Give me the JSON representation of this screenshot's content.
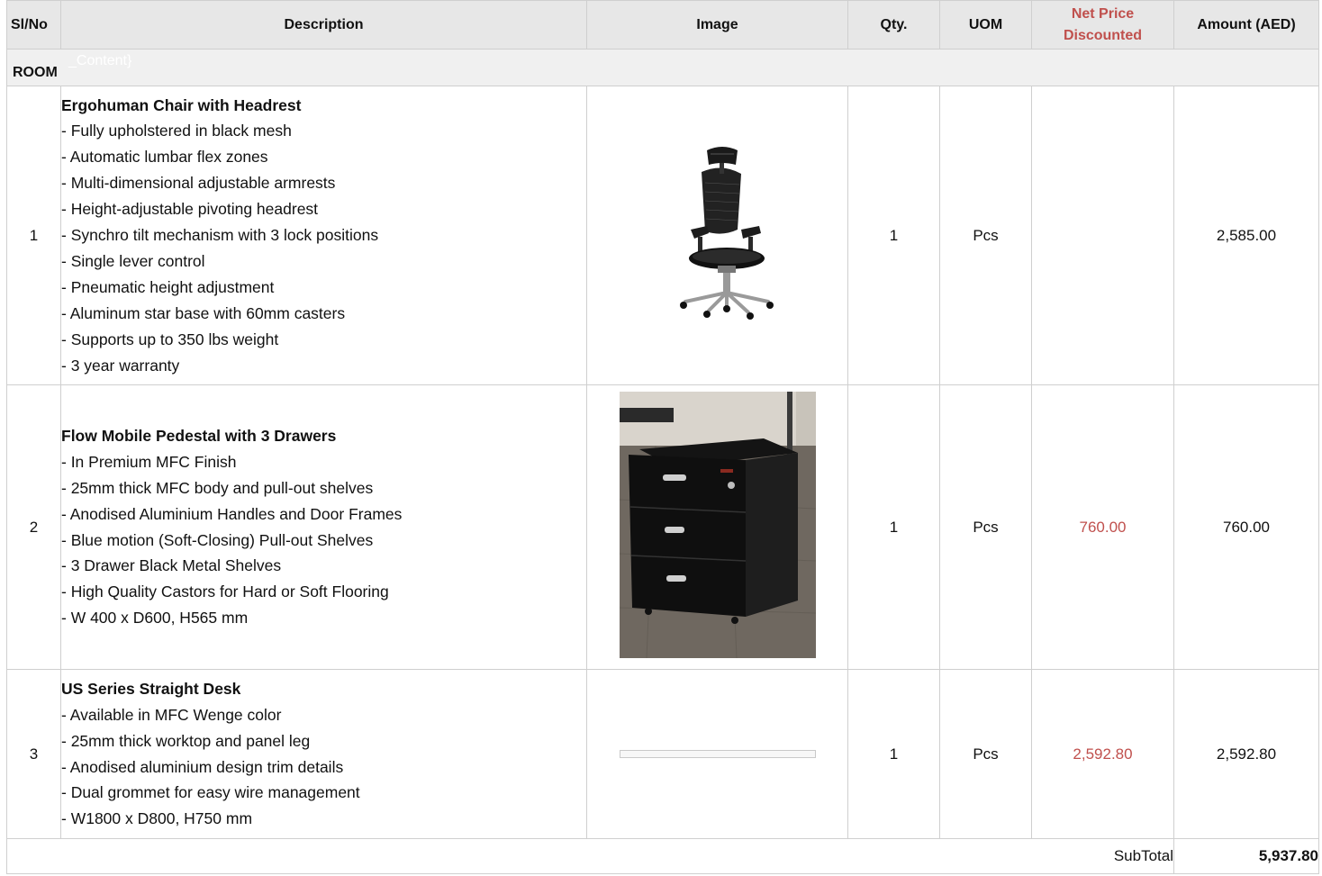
{
  "columns": {
    "slno": "Sl/No",
    "description": "Description",
    "image": "Image",
    "qty": "Qty.",
    "uom": "UOM",
    "net_price_line1": "Net Price",
    "net_price_line2": "Discounted",
    "amount": "Amount (AED)"
  },
  "section": {
    "label": "ROOM",
    "ghost_text": "_Content}"
  },
  "rows": [
    {
      "slno": "1",
      "title": "Ergohuman Chair with Headrest",
      "lines": [
        "- Fully upholstered in black mesh",
        "- Automatic lumbar flex zones",
        "- Multi-dimensional adjustable armrests",
        "- Height-adjustable pivoting headrest",
        "- Synchro tilt mechanism with 3 lock positions",
        "- Single lever control",
        "- Pneumatic height adjustment",
        "- Aluminum star base with 60mm casters",
        "- Supports up to 350 lbs weight",
        "- 3 year warranty"
      ],
      "image_icon": "office-chair-photo",
      "qty": "1",
      "uom": "Pcs",
      "net_price": "",
      "amount": "2,585.00"
    },
    {
      "slno": "2",
      "title": "Flow Mobile Pedestal with 3 Drawers",
      "lines": [
        "- In Premium MFC Finish",
        "- 25mm thick MFC body and pull-out shelves",
        "- Anodised Aluminium Handles and Door Frames",
        "- Blue motion (Soft-Closing) Pull-out Shelves",
        "- 3 Drawer Black Metal Shelves",
        "- High Quality Castors for Hard or Soft Flooring",
        "- W 400 x D600, H565 mm"
      ],
      "image_icon": "pedestal-photo",
      "qty": "1",
      "uom": "Pcs",
      "net_price": "760.00",
      "amount": "760.00"
    },
    {
      "slno": "3",
      "title": "US Series Straight Desk",
      "lines": [
        "- Available in MFC Wenge color",
        "- 25mm thick worktop and panel leg",
        "- Anodised aluminium design trim details",
        "- Dual grommet for easy wire management",
        "- W1800 x D800, H750 mm"
      ],
      "image_icon": "desk-photo",
      "qty": "1",
      "uom": "Pcs",
      "net_price": "2,592.80",
      "amount": "2,592.80"
    }
  ],
  "subtotal": {
    "label": "SubTotal",
    "value": "5,937.80"
  },
  "colors": {
    "header_bg": "#e7e7e7",
    "section_bg": "#f0f0f0",
    "accent_red": "#c0504d",
    "grid": "#cfcfcf"
  }
}
